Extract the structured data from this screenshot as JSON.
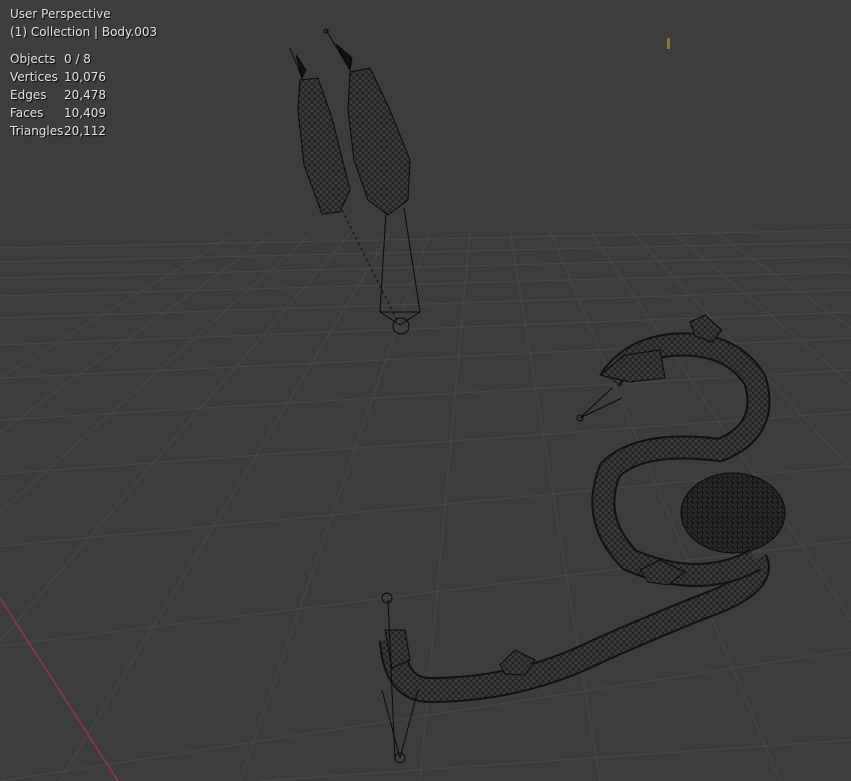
{
  "viewport": {
    "view_name": "User Perspective",
    "collection_line": "(1) Collection | Body.003",
    "stats": [
      {
        "label": "Objects",
        "value": "0 / 8"
      },
      {
        "label": "Vertices",
        "value": "10,076"
      },
      {
        "label": "Edges",
        "value": "20,478"
      },
      {
        "label": "Faces",
        "value": "10,409"
      },
      {
        "label": "Triangles",
        "value": "20,112"
      }
    ]
  },
  "colors": {
    "background": "#3d3d3d",
    "grid": "#4a4a4a",
    "x_axis": "#8a3b45",
    "wire": "#0a0a0a",
    "text": "#e6e6e6"
  }
}
